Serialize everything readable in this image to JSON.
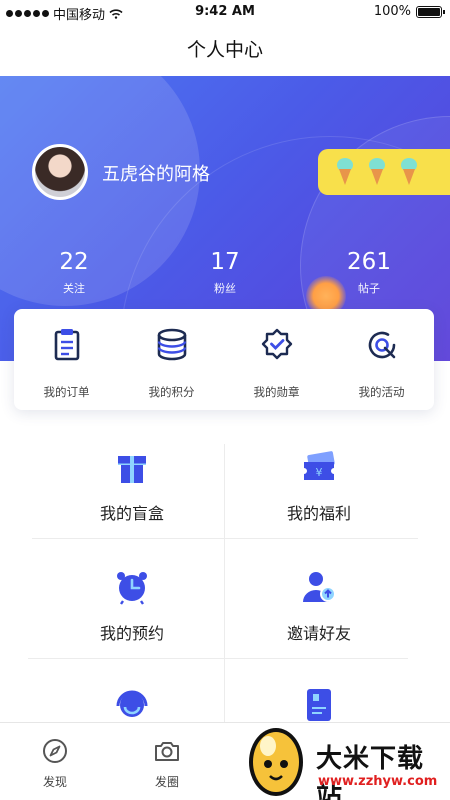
{
  "status_bar": {
    "carrier": "中国移动",
    "time": "9:42 AM",
    "battery": "100%"
  },
  "nav": {
    "title": "个人中心"
  },
  "profile": {
    "username": "五虎谷的阿格"
  },
  "stats": [
    {
      "value": "22",
      "label": "关注"
    },
    {
      "value": "17",
      "label": "粉丝"
    },
    {
      "value": "261",
      "label": "帖子"
    }
  ],
  "quick_actions": [
    {
      "label": "我的订单",
      "icon": "clipboard-icon"
    },
    {
      "label": "我的积分",
      "icon": "database-icon"
    },
    {
      "label": "我的勋章",
      "icon": "medal-icon"
    },
    {
      "label": "我的活动",
      "icon": "target-icon"
    }
  ],
  "grid_items": [
    {
      "label": "我的盲盒",
      "icon": "gift-box-icon"
    },
    {
      "label": "我的福利",
      "icon": "ticket-icon"
    },
    {
      "label": "我的预约",
      "icon": "alarm-clock-icon"
    },
    {
      "label": "邀请好友",
      "icon": "add-user-icon"
    },
    {
      "label": "",
      "icon": "headset-icon"
    },
    {
      "label": "",
      "icon": "book-icon"
    }
  ],
  "tabs": [
    {
      "label": "发现",
      "icon": "compass-icon"
    },
    {
      "label": "发圈",
      "icon": "camera-icon"
    }
  ],
  "watermark": {
    "title": "大米下载站",
    "url": "www.zzhyw.com"
  },
  "colors": {
    "accent": "#4b5be8",
    "icon_blue": "#3d4ee6",
    "badge_yellow": "#f8e04b"
  }
}
